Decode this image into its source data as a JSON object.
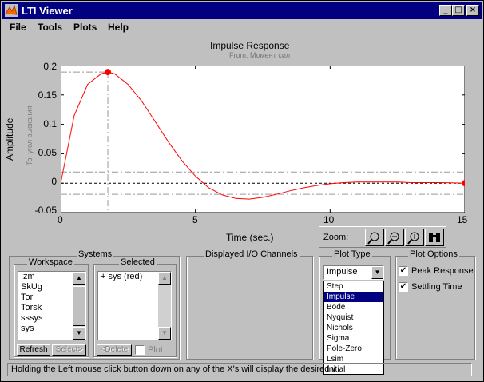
{
  "window": {
    "title": "LTI Viewer",
    "minimize": "_",
    "maximize": "□",
    "close": "×"
  },
  "menu": [
    "File",
    "Tools",
    "Plots",
    "Help"
  ],
  "plot": {
    "title": "Impulse Response",
    "subtitle": "From: Момент сил",
    "ylabel": "Amplitude",
    "ylabel_sub": "To: угол рыскания",
    "xlabel": "Time (sec.)",
    "yticks": [
      "0.2",
      "0.15",
      "0.1",
      "0.05",
      "0",
      "-0.05"
    ],
    "xticks": [
      "0",
      "5",
      "10",
      "15"
    ]
  },
  "chart_data": {
    "type": "line",
    "title": "Impulse Response",
    "subtitle": "From: Момент сил",
    "xlabel": "Time (sec.)",
    "ylabel": "Amplitude",
    "xlim": [
      0,
      15
    ],
    "ylim": [
      -0.05,
      0.2
    ],
    "series": [
      {
        "name": "sys",
        "color": "#ff0000",
        "x": [
          0,
          0.5,
          1,
          1.5,
          1.75,
          2,
          2.5,
          3,
          3.5,
          4,
          4.5,
          5,
          5.5,
          6,
          6.5,
          7,
          7.5,
          8,
          8.5,
          9,
          9.5,
          10,
          10.5,
          11,
          11.5,
          12,
          12.5,
          13,
          13.5,
          14,
          14.5,
          15
        ],
        "y": [
          0,
          0.115,
          0.168,
          0.186,
          0.189,
          0.186,
          0.168,
          0.14,
          0.105,
          0.07,
          0.038,
          0.012,
          -0.008,
          -0.02,
          -0.026,
          -0.027,
          -0.024,
          -0.019,
          -0.013,
          -0.008,
          -0.004,
          -0.001,
          0.001,
          0.002,
          0.002,
          0.002,
          0.002,
          0.001,
          0.001,
          0.001,
          0.0005,
          0
        ]
      }
    ],
    "markers": {
      "peak": {
        "x": 1.75,
        "y": 0.189
      },
      "settling": {
        "x": 15,
        "y": 0
      }
    },
    "settling_band": [
      0.019,
      -0.019
    ],
    "grid": false
  },
  "zoom": {
    "label": "Zoom:"
  },
  "systems": {
    "frame_label": "Systems",
    "workspace_label": "Workspace",
    "workspace_items": [
      "Izm",
      "SkUg",
      "Tor",
      "Torsk",
      "sssys",
      "sys"
    ],
    "selected_label": "Selected",
    "selected_items": [
      "+ sys (red)"
    ],
    "refresh": "Refresh",
    "select": "Select>",
    "delete": "<Delete",
    "plot_label": "Plot"
  },
  "io": {
    "label": "Displayed I/O Channels"
  },
  "plot_type": {
    "label": "Plot Type",
    "value": "Impulse",
    "options": [
      "Step",
      "Impulse",
      "Bode",
      "Nyquist",
      "Nichols",
      "Sigma",
      "Pole-Zero",
      "Lsim",
      "Initial"
    ],
    "selected_index": 1
  },
  "plot_options": {
    "label": "Plot Options",
    "peak": "Peak Response",
    "settling": "Settling Time",
    "peak_checked": true,
    "settling_checked": true
  },
  "status": "Holding the Left mouse click button down on any of the X's will display the desired v"
}
